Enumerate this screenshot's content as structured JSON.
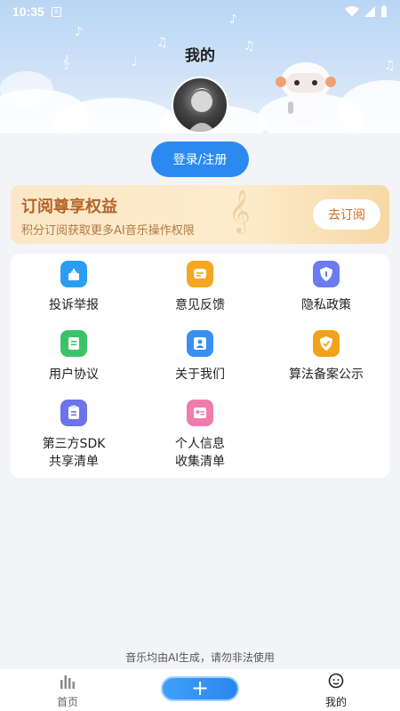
{
  "status_bar": {
    "time": "10:35"
  },
  "header": {
    "title": "我的"
  },
  "login": {
    "label": "登录/注册"
  },
  "subscription": {
    "title": "订阅尊享权益",
    "description": "积分订阅获取更多AI音乐操作权限",
    "button": "去订阅"
  },
  "menu": {
    "items": [
      {
        "label": "投诉举报",
        "icon": "report-icon",
        "color": "#2b9df0"
      },
      {
        "label": "意见反馈",
        "icon": "feedback-icon",
        "color": "#f5a623"
      },
      {
        "label": "隐私政策",
        "icon": "shield-icon",
        "color": "#6c7bf0"
      },
      {
        "label": "用户协议",
        "icon": "document-icon",
        "color": "#3cc36a"
      },
      {
        "label": "关于我们",
        "icon": "contact-icon",
        "color": "#3a8ff0"
      },
      {
        "label": "算法备案公示",
        "icon": "badge-icon",
        "color": "#f2a11a"
      },
      {
        "label": "第三方SDK\n共享清单",
        "label_line1": "第三方SDK",
        "label_line2": "共享清单",
        "icon": "clipboard-icon",
        "color": "#6b74e8"
      },
      {
        "label": "个人信息\n收集清单",
        "label_line1": "个人信息",
        "label_line2": "收集清单",
        "icon": "id-card-icon",
        "color": "#f07cae"
      }
    ]
  },
  "footer": {
    "note": "音乐均由AI生成，请勿非法使用"
  },
  "tabbar": {
    "home": "首页",
    "mine": "我的"
  },
  "colors": {
    "primary": "#2b8af0",
    "accent_orange": "#d2691e"
  }
}
